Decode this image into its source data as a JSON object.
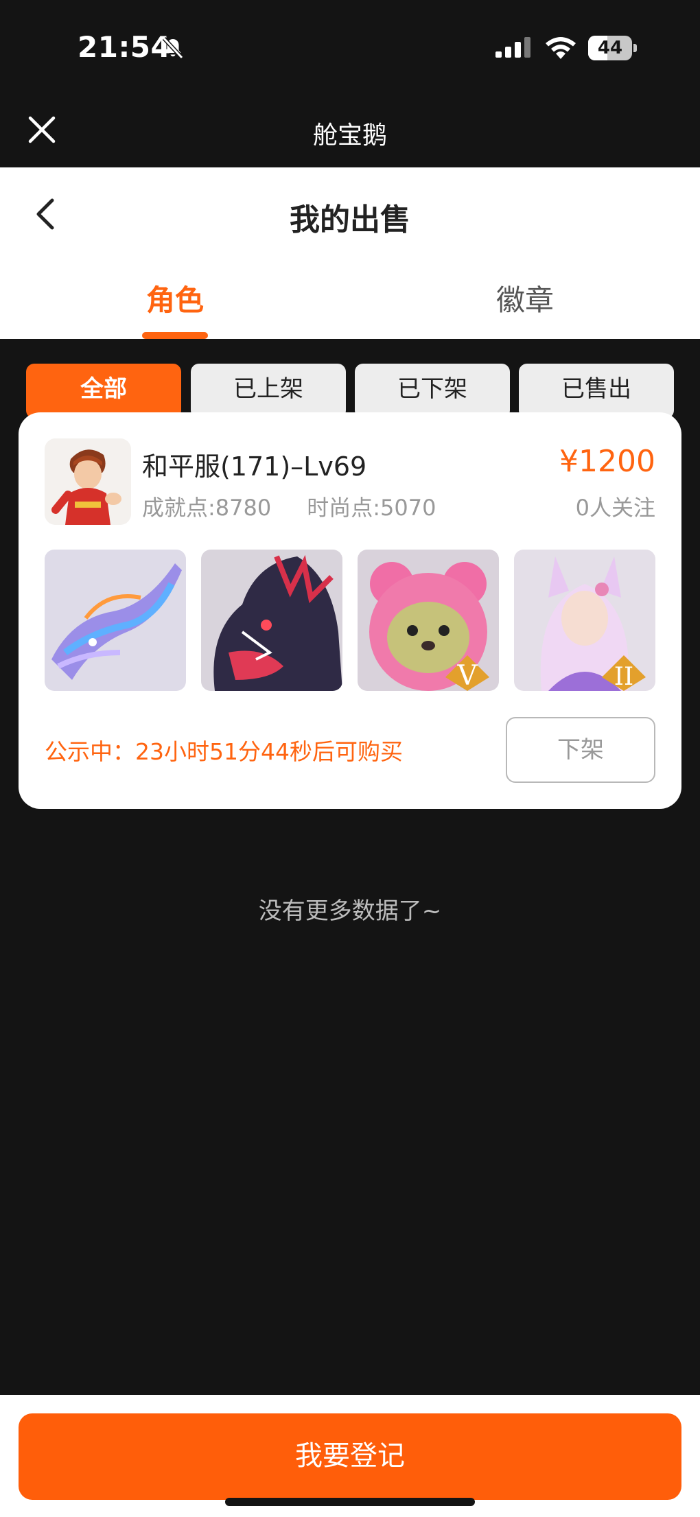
{
  "status_bar": {
    "time": "21:54",
    "battery": "44",
    "battery_level": 0.44
  },
  "app_bar": {
    "title": "舱宝鹅"
  },
  "header": {
    "title": "我的出售",
    "tabs": [
      {
        "label": "角色"
      },
      {
        "label": "徽章"
      }
    ],
    "active_tab": "角色"
  },
  "filters": [
    {
      "label": "全部"
    },
    {
      "label": "已上架"
    },
    {
      "label": "已下架"
    },
    {
      "label": "已售出"
    }
  ],
  "listing": {
    "title": "和平服(171)–Lv69",
    "achievement": "成就点:8780",
    "fashion": "时尚点:5070",
    "price": "¥1200",
    "followers": "0人关注",
    "items": [
      {
        "name": "blue-dragon",
        "badge": ""
      },
      {
        "name": "dark-dragon",
        "badge": ""
      },
      {
        "name": "pink-bear",
        "badge": "V"
      },
      {
        "name": "fox-girl",
        "badge": "II"
      }
    ],
    "notice": "公示中：23小时51分44秒后可购买",
    "delist_label": "下架"
  },
  "empty_text": "没有更多数据了~",
  "bottom": {
    "register_label": "我要登记"
  },
  "colors": {
    "accent": "#ff6410",
    "background": "#141414"
  }
}
